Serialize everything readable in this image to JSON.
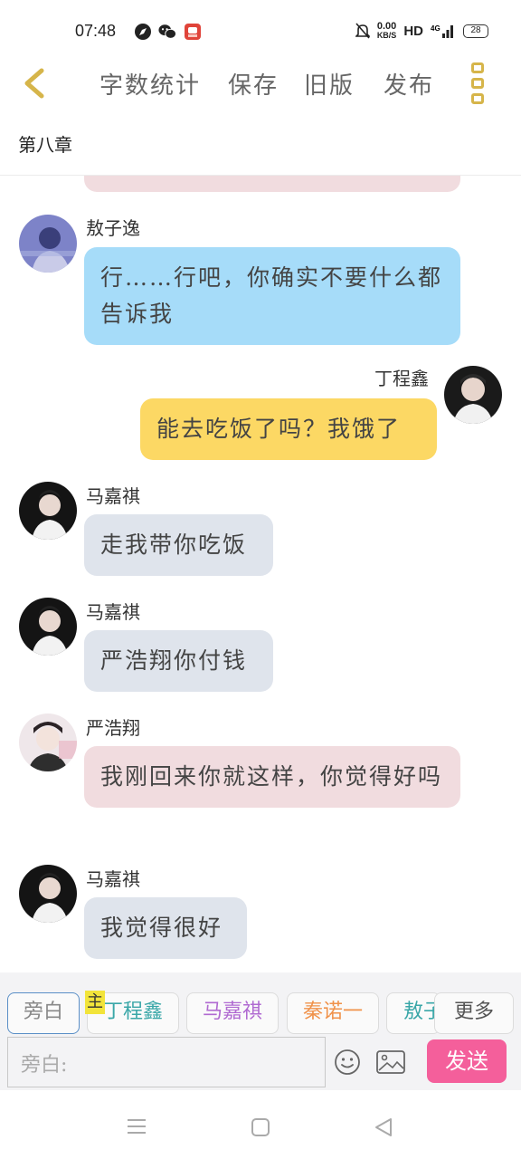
{
  "status_bar": {
    "time": "07:48",
    "net_speed_value": "0.00",
    "net_speed_unit": "KB/S",
    "hd": "HD",
    "signal": "4G",
    "battery": "28",
    "icons": [
      "compass-icon",
      "wechat-icon",
      "app-icon",
      "bell-off-icon"
    ]
  },
  "header": {
    "word_count": "字数统计",
    "save": "保存",
    "old_version": "旧版",
    "publish": "发布"
  },
  "chapter_title": "第八章",
  "messages": [
    {
      "speaker": "敖子逸",
      "text": "行……行吧，你确实不要什么都告诉我",
      "side": "left",
      "bubble_color": "#a6dcf9"
    },
    {
      "speaker": "丁程鑫",
      "text": "能去吃饭了吗？我饿了",
      "side": "right",
      "bubble_color": "#fcd864"
    },
    {
      "speaker": "马嘉祺",
      "text": "走我带你吃饭",
      "side": "left",
      "bubble_color": "#dfe4ec"
    },
    {
      "speaker": "马嘉祺",
      "text": "严浩翔你付钱",
      "side": "left",
      "bubble_color": "#dfe4ec"
    },
    {
      "speaker": "严浩翔",
      "text": "我刚回来你就这样，你觉得好吗",
      "side": "left",
      "bubble_color": "#f1dcdf"
    },
    {
      "speaker": "马嘉祺",
      "text": "我觉得很好",
      "side": "left",
      "bubble_color": "#dfe4ec"
    }
  ],
  "roles": {
    "narration": "旁白",
    "main_mark": "主",
    "r1": "丁程鑫",
    "r2": "马嘉祺",
    "r3": "秦诺一",
    "r4": "敖子逸",
    "more": "更多"
  },
  "role_colors": {
    "r1": "#3aa7a8",
    "r2": "#b06ad1",
    "r3": "#f0924a",
    "r4": "#3aa7a8"
  },
  "composer": {
    "placeholder": "旁白:",
    "send": "发送"
  },
  "colors": {
    "accent": "#d6b54a",
    "send": "#f45f9b"
  }
}
